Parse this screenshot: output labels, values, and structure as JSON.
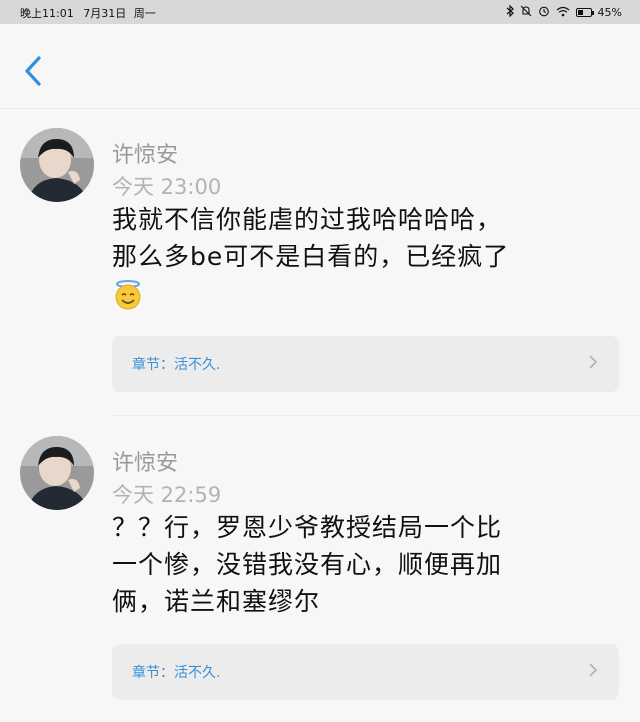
{
  "status_bar": {
    "time": "晚上11:01",
    "date": "7月31日",
    "weekday": "周一",
    "battery": "45%",
    "battery_level": 0.45,
    "icons": [
      "bluetooth-icon",
      "silent-icon",
      "alarm-icon",
      "wifi-icon",
      "battery-icon"
    ]
  },
  "header": {
    "back_icon": "chevron-left-icon",
    "accent_color": "#2f8fe0"
  },
  "comments": [
    {
      "user": "许惊安",
      "time": "今天 23:00",
      "text_lines": [
        "我就不信你能虐的过我哈哈哈哈，",
        "那么多be可不是白看的，已经疯了"
      ],
      "emoji": "smiling-face-with-halo-icon",
      "chapter_label": "章节：活不久."
    },
    {
      "user": "许惊安",
      "time": "今天 22:59",
      "text_lines": [
        "？？行，罗恩少爷教授结局一个比",
        "一个惨，没错我没有心，顺便再加",
        "俩，诺兰和塞缪尔"
      ],
      "chapter_label": "章节：活不久."
    }
  ]
}
